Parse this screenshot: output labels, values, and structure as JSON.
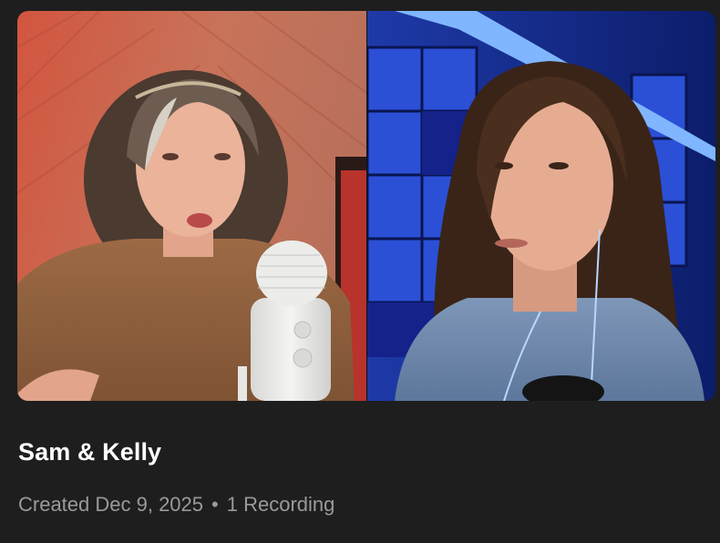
{
  "recording_card": {
    "title": "Sam & Kelly",
    "created": "Created Dec 9, 2025",
    "separator": "•",
    "recordings_count": "1 Recording"
  },
  "participants": [
    {
      "tile": "left",
      "description_icon": "participant-video-left"
    },
    {
      "tile": "right",
      "description_icon": "participant-video-right"
    }
  ],
  "colors": {
    "background": "#1e1e1e",
    "title": "#ffffff",
    "meta": "#9a9a9a"
  }
}
